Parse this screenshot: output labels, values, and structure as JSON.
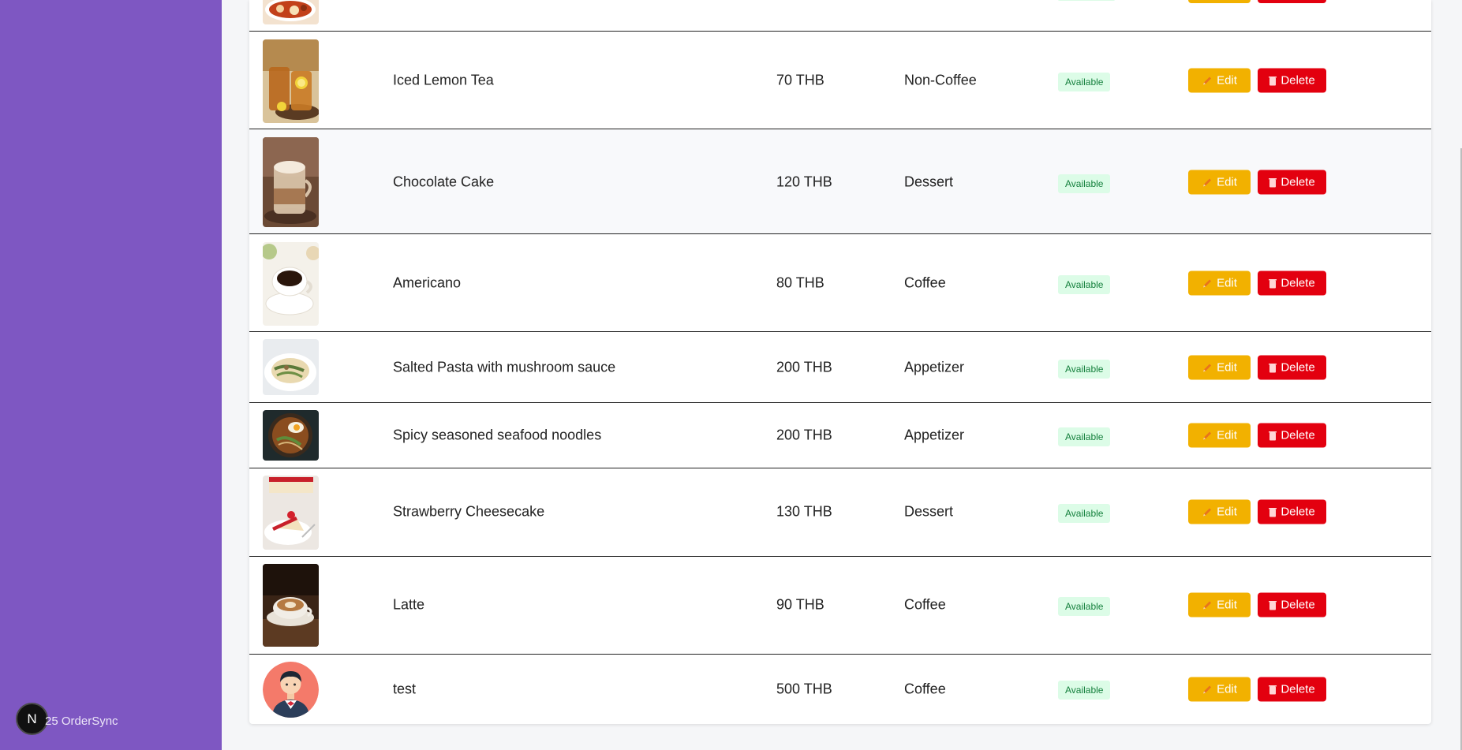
{
  "sidebar": {
    "footer_text": "25 OrderSync",
    "avatar_letter": "N",
    "color": "#7e57c2"
  },
  "actions": {
    "edit_label": "Edit",
    "delete_label": "Delete",
    "edit_color": "#f2b100",
    "delete_color": "#e3000f"
  },
  "status_colors": {
    "available_bg": "#dcfce7",
    "available_fg": "#15803d"
  },
  "menu_items": [
    {
      "name": "",
      "price": "",
      "category": "",
      "status": "",
      "image": "spicy-dish-image"
    },
    {
      "name": "Iced Lemon Tea",
      "price": "70 THB",
      "category": "Non-Coffee",
      "status": "Available",
      "image": "iced-tea-image"
    },
    {
      "name": "Chocolate Cake",
      "price": "120 THB",
      "category": "Dessert",
      "status": "Available",
      "image": "mocha-image"
    },
    {
      "name": "Americano",
      "price": "80 THB",
      "category": "Coffee",
      "status": "Available",
      "image": "coffee-cup-image"
    },
    {
      "name": "Salted Pasta with mushroom sauce",
      "price": "200 THB",
      "category": "Appetizer",
      "status": "Available",
      "image": "pasta-image"
    },
    {
      "name": "Spicy seasoned seafood noodles",
      "price": "200 THB",
      "category": "Appetizer",
      "status": "Available",
      "image": "noodles-image"
    },
    {
      "name": "Strawberry Cheesecake",
      "price": "130 THB",
      "category": "Dessert",
      "status": "Available",
      "image": "cheesecake-image"
    },
    {
      "name": "Latte",
      "price": "90 THB",
      "category": "Coffee",
      "status": "Available",
      "image": "latte-image"
    },
    {
      "name": "test",
      "price": "500 THB",
      "category": "Coffee",
      "status": "Available",
      "image": "waiter-avatar-image"
    }
  ]
}
